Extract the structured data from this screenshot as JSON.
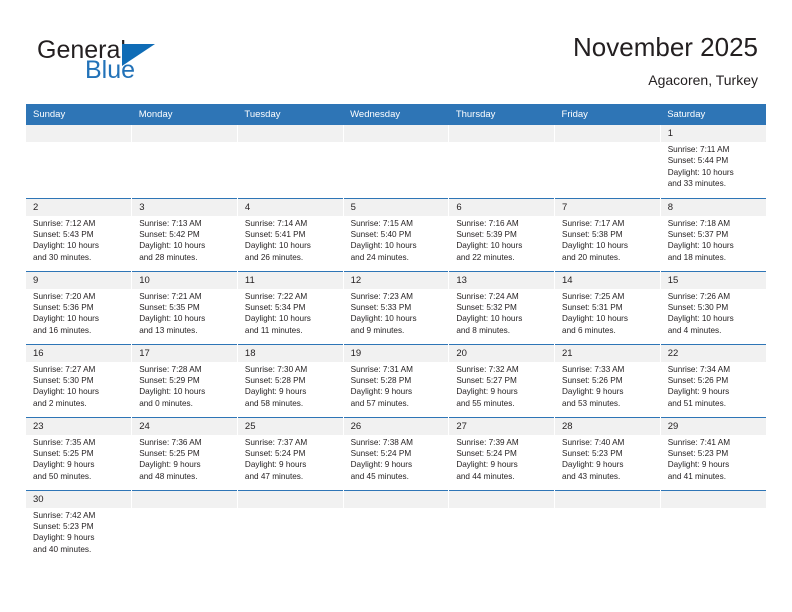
{
  "brand": {
    "name_top": "General",
    "name_bottom": "Blue",
    "accent_color": "#0f6cb6",
    "text_color": "#231f20"
  },
  "header": {
    "title": "November 2025",
    "subtitle": "Agacoren, Turkey",
    "header_bg": "#2e75b6",
    "daynum_bg": "#f1f1f1"
  },
  "weekday_headers": [
    "Sunday",
    "Monday",
    "Tuesday",
    "Wednesday",
    "Thursday",
    "Friday",
    "Saturday"
  ],
  "labels": {
    "sunrise_prefix": "Sunrise:",
    "sunset_prefix": "Sunset:",
    "daylight_prefix": "Daylight:"
  },
  "weeks": [
    [
      {
        "day": "",
        "sunrise": "",
        "sunset": "",
        "daylight_line1": "",
        "daylight_line2": "",
        "empty": true
      },
      {
        "day": "",
        "sunrise": "",
        "sunset": "",
        "daylight_line1": "",
        "daylight_line2": "",
        "empty": true
      },
      {
        "day": "",
        "sunrise": "",
        "sunset": "",
        "daylight_line1": "",
        "daylight_line2": "",
        "empty": true
      },
      {
        "day": "",
        "sunrise": "",
        "sunset": "",
        "daylight_line1": "",
        "daylight_line2": "",
        "empty": true
      },
      {
        "day": "",
        "sunrise": "",
        "sunset": "",
        "daylight_line1": "",
        "daylight_line2": "",
        "empty": true
      },
      {
        "day": "",
        "sunrise": "",
        "sunset": "",
        "daylight_line1": "",
        "daylight_line2": "",
        "empty": true
      },
      {
        "day": "1",
        "sunrise": "Sunrise: 7:11 AM",
        "sunset": "Sunset: 5:44 PM",
        "daylight_line1": "Daylight: 10 hours",
        "daylight_line2": "and 33 minutes."
      }
    ],
    [
      {
        "day": "2",
        "sunrise": "Sunrise: 7:12 AM",
        "sunset": "Sunset: 5:43 PM",
        "daylight_line1": "Daylight: 10 hours",
        "daylight_line2": "and 30 minutes."
      },
      {
        "day": "3",
        "sunrise": "Sunrise: 7:13 AM",
        "sunset": "Sunset: 5:42 PM",
        "daylight_line1": "Daylight: 10 hours",
        "daylight_line2": "and 28 minutes."
      },
      {
        "day": "4",
        "sunrise": "Sunrise: 7:14 AM",
        "sunset": "Sunset: 5:41 PM",
        "daylight_line1": "Daylight: 10 hours",
        "daylight_line2": "and 26 minutes."
      },
      {
        "day": "5",
        "sunrise": "Sunrise: 7:15 AM",
        "sunset": "Sunset: 5:40 PM",
        "daylight_line1": "Daylight: 10 hours",
        "daylight_line2": "and 24 minutes."
      },
      {
        "day": "6",
        "sunrise": "Sunrise: 7:16 AM",
        "sunset": "Sunset: 5:39 PM",
        "daylight_line1": "Daylight: 10 hours",
        "daylight_line2": "and 22 minutes."
      },
      {
        "day": "7",
        "sunrise": "Sunrise: 7:17 AM",
        "sunset": "Sunset: 5:38 PM",
        "daylight_line1": "Daylight: 10 hours",
        "daylight_line2": "and 20 minutes."
      },
      {
        "day": "8",
        "sunrise": "Sunrise: 7:18 AM",
        "sunset": "Sunset: 5:37 PM",
        "daylight_line1": "Daylight: 10 hours",
        "daylight_line2": "and 18 minutes."
      }
    ],
    [
      {
        "day": "9",
        "sunrise": "Sunrise: 7:20 AM",
        "sunset": "Sunset: 5:36 PM",
        "daylight_line1": "Daylight: 10 hours",
        "daylight_line2": "and 16 minutes."
      },
      {
        "day": "10",
        "sunrise": "Sunrise: 7:21 AM",
        "sunset": "Sunset: 5:35 PM",
        "daylight_line1": "Daylight: 10 hours",
        "daylight_line2": "and 13 minutes."
      },
      {
        "day": "11",
        "sunrise": "Sunrise: 7:22 AM",
        "sunset": "Sunset: 5:34 PM",
        "daylight_line1": "Daylight: 10 hours",
        "daylight_line2": "and 11 minutes."
      },
      {
        "day": "12",
        "sunrise": "Sunrise: 7:23 AM",
        "sunset": "Sunset: 5:33 PM",
        "daylight_line1": "Daylight: 10 hours",
        "daylight_line2": "and 9 minutes."
      },
      {
        "day": "13",
        "sunrise": "Sunrise: 7:24 AM",
        "sunset": "Sunset: 5:32 PM",
        "daylight_line1": "Daylight: 10 hours",
        "daylight_line2": "and 8 minutes."
      },
      {
        "day": "14",
        "sunrise": "Sunrise: 7:25 AM",
        "sunset": "Sunset: 5:31 PM",
        "daylight_line1": "Daylight: 10 hours",
        "daylight_line2": "and 6 minutes."
      },
      {
        "day": "15",
        "sunrise": "Sunrise: 7:26 AM",
        "sunset": "Sunset: 5:30 PM",
        "daylight_line1": "Daylight: 10 hours",
        "daylight_line2": "and 4 minutes."
      }
    ],
    [
      {
        "day": "16",
        "sunrise": "Sunrise: 7:27 AM",
        "sunset": "Sunset: 5:30 PM",
        "daylight_line1": "Daylight: 10 hours",
        "daylight_line2": "and 2 minutes."
      },
      {
        "day": "17",
        "sunrise": "Sunrise: 7:28 AM",
        "sunset": "Sunset: 5:29 PM",
        "daylight_line1": "Daylight: 10 hours",
        "daylight_line2": "and 0 minutes."
      },
      {
        "day": "18",
        "sunrise": "Sunrise: 7:30 AM",
        "sunset": "Sunset: 5:28 PM",
        "daylight_line1": "Daylight: 9 hours",
        "daylight_line2": "and 58 minutes."
      },
      {
        "day": "19",
        "sunrise": "Sunrise: 7:31 AM",
        "sunset": "Sunset: 5:28 PM",
        "daylight_line1": "Daylight: 9 hours",
        "daylight_line2": "and 57 minutes."
      },
      {
        "day": "20",
        "sunrise": "Sunrise: 7:32 AM",
        "sunset": "Sunset: 5:27 PM",
        "daylight_line1": "Daylight: 9 hours",
        "daylight_line2": "and 55 minutes."
      },
      {
        "day": "21",
        "sunrise": "Sunrise: 7:33 AM",
        "sunset": "Sunset: 5:26 PM",
        "daylight_line1": "Daylight: 9 hours",
        "daylight_line2": "and 53 minutes."
      },
      {
        "day": "22",
        "sunrise": "Sunrise: 7:34 AM",
        "sunset": "Sunset: 5:26 PM",
        "daylight_line1": "Daylight: 9 hours",
        "daylight_line2": "and 51 minutes."
      }
    ],
    [
      {
        "day": "23",
        "sunrise": "Sunrise: 7:35 AM",
        "sunset": "Sunset: 5:25 PM",
        "daylight_line1": "Daylight: 9 hours",
        "daylight_line2": "and 50 minutes."
      },
      {
        "day": "24",
        "sunrise": "Sunrise: 7:36 AM",
        "sunset": "Sunset: 5:25 PM",
        "daylight_line1": "Daylight: 9 hours",
        "daylight_line2": "and 48 minutes."
      },
      {
        "day": "25",
        "sunrise": "Sunrise: 7:37 AM",
        "sunset": "Sunset: 5:24 PM",
        "daylight_line1": "Daylight: 9 hours",
        "daylight_line2": "and 47 minutes."
      },
      {
        "day": "26",
        "sunrise": "Sunrise: 7:38 AM",
        "sunset": "Sunset: 5:24 PM",
        "daylight_line1": "Daylight: 9 hours",
        "daylight_line2": "and 45 minutes."
      },
      {
        "day": "27",
        "sunrise": "Sunrise: 7:39 AM",
        "sunset": "Sunset: 5:24 PM",
        "daylight_line1": "Daylight: 9 hours",
        "daylight_line2": "and 44 minutes."
      },
      {
        "day": "28",
        "sunrise": "Sunrise: 7:40 AM",
        "sunset": "Sunset: 5:23 PM",
        "daylight_line1": "Daylight: 9 hours",
        "daylight_line2": "and 43 minutes."
      },
      {
        "day": "29",
        "sunrise": "Sunrise: 7:41 AM",
        "sunset": "Sunset: 5:23 PM",
        "daylight_line1": "Daylight: 9 hours",
        "daylight_line2": "and 41 minutes."
      }
    ],
    [
      {
        "day": "30",
        "sunrise": "Sunrise: 7:42 AM",
        "sunset": "Sunset: 5:23 PM",
        "daylight_line1": "Daylight: 9 hours",
        "daylight_line2": "and 40 minutes."
      },
      {
        "day": "",
        "sunrise": "",
        "sunset": "",
        "daylight_line1": "",
        "daylight_line2": "",
        "empty": true
      },
      {
        "day": "",
        "sunrise": "",
        "sunset": "",
        "daylight_line1": "",
        "daylight_line2": "",
        "empty": true
      },
      {
        "day": "",
        "sunrise": "",
        "sunset": "",
        "daylight_line1": "",
        "daylight_line2": "",
        "empty": true
      },
      {
        "day": "",
        "sunrise": "",
        "sunset": "",
        "daylight_line1": "",
        "daylight_line2": "",
        "empty": true
      },
      {
        "day": "",
        "sunrise": "",
        "sunset": "",
        "daylight_line1": "",
        "daylight_line2": "",
        "empty": true
      },
      {
        "day": "",
        "sunrise": "",
        "sunset": "",
        "daylight_line1": "",
        "daylight_line2": "",
        "empty": true
      }
    ]
  ]
}
